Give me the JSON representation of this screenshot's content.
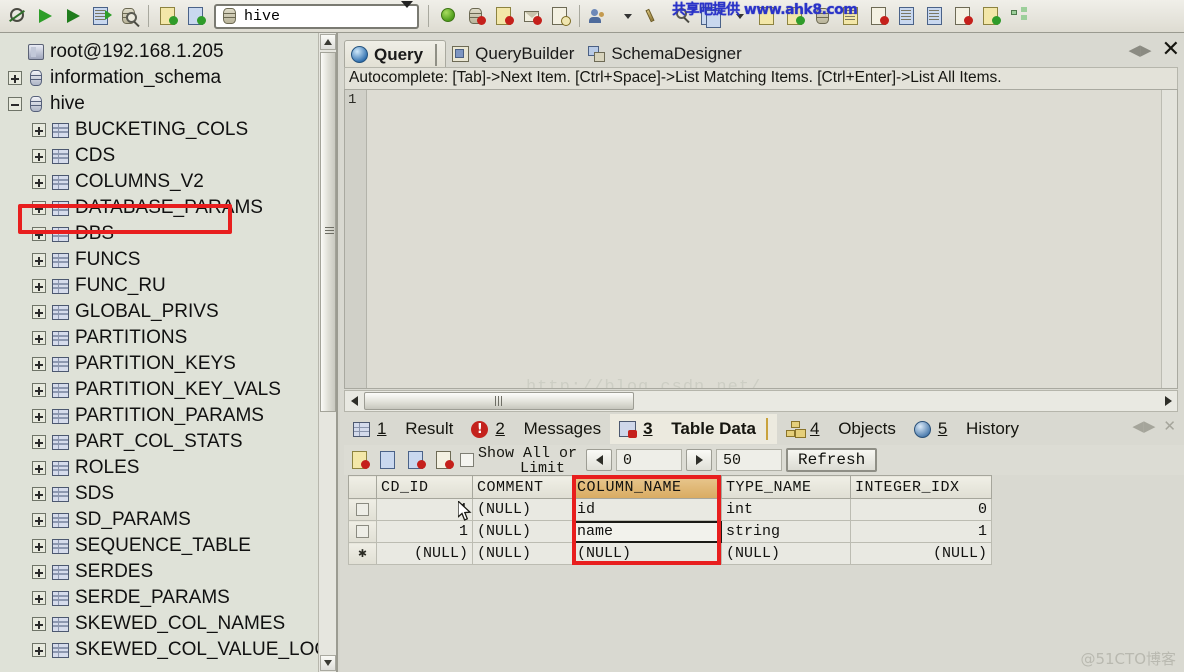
{
  "toolbar": {
    "database_value": "hive",
    "icons": [
      "connect-icon",
      "execute-icon",
      "execute-current-icon",
      "execute-to-grid-icon",
      "explain-plan-icon",
      "import-icon",
      "export-icon"
    ],
    "watermark": "共享吧提供 www.ahk8.com"
  },
  "tree": {
    "items": [
      {
        "label": "root@192.168.1.205",
        "level": 0,
        "icon": "server-icon",
        "expander": "none"
      },
      {
        "label": "information_schema",
        "level": 1,
        "icon": "database-icon",
        "expander": "plus"
      },
      {
        "label": "hive",
        "level": 1,
        "icon": "database-icon",
        "expander": "minus"
      },
      {
        "label": "BUCKETING_COLS",
        "level": 2,
        "icon": "table-icon",
        "expander": "plus"
      },
      {
        "label": "CDS",
        "level": 2,
        "icon": "table-icon",
        "expander": "plus"
      },
      {
        "label": "COLUMNS_V2",
        "level": 2,
        "icon": "table-icon",
        "expander": "plus"
      },
      {
        "label": "DATABASE_PARAMS",
        "level": 2,
        "icon": "table-icon",
        "expander": "plus"
      },
      {
        "label": "DBS",
        "level": 2,
        "icon": "table-icon",
        "expander": "plus"
      },
      {
        "label": "FUNCS",
        "level": 2,
        "icon": "table-icon",
        "expander": "plus"
      },
      {
        "label": "FUNC_RU",
        "level": 2,
        "icon": "table-icon",
        "expander": "plus"
      },
      {
        "label": "GLOBAL_PRIVS",
        "level": 2,
        "icon": "table-icon",
        "expander": "plus"
      },
      {
        "label": "PARTITIONS",
        "level": 2,
        "icon": "table-icon",
        "expander": "plus"
      },
      {
        "label": "PARTITION_KEYS",
        "level": 2,
        "icon": "table-icon",
        "expander": "plus"
      },
      {
        "label": "PARTITION_KEY_VALS",
        "level": 2,
        "icon": "table-icon",
        "expander": "plus"
      },
      {
        "label": "PARTITION_PARAMS",
        "level": 2,
        "icon": "table-icon",
        "expander": "plus"
      },
      {
        "label": "PART_COL_STATS",
        "level": 2,
        "icon": "table-icon",
        "expander": "plus"
      },
      {
        "label": "ROLES",
        "level": 2,
        "icon": "table-icon",
        "expander": "plus"
      },
      {
        "label": "SDS",
        "level": 2,
        "icon": "table-icon",
        "expander": "plus"
      },
      {
        "label": "SD_PARAMS",
        "level": 2,
        "icon": "table-icon",
        "expander": "plus"
      },
      {
        "label": "SEQUENCE_TABLE",
        "level": 2,
        "icon": "table-icon",
        "expander": "plus"
      },
      {
        "label": "SERDES",
        "level": 2,
        "icon": "table-icon",
        "expander": "plus"
      },
      {
        "label": "SERDE_PARAMS",
        "level": 2,
        "icon": "table-icon",
        "expander": "plus"
      },
      {
        "label": "SKEWED_COL_NAMES",
        "level": 2,
        "icon": "table-icon",
        "expander": "plus"
      },
      {
        "label": "SKEWED_COL_VALUE_LOC_M",
        "level": 2,
        "icon": "table-icon",
        "expander": "plus"
      }
    ],
    "highlight_label": "COLUMNS_V2",
    "highlight_color": "#e81e1e"
  },
  "query_panel": {
    "tabs": [
      {
        "label": "Query",
        "icon": "globe-icon",
        "active": true
      },
      {
        "label": "QueryBuilder",
        "icon": "query-builder-icon",
        "active": false
      },
      {
        "label": "SchemaDesigner",
        "icon": "schema-designer-icon",
        "active": false
      }
    ],
    "close_label": "✕",
    "autocomplete_hint": "Autocomplete: [Tab]->Next Item. [Ctrl+Space]->List Matching Items. [Ctrl+Enter]->List All Items.",
    "line_number": "1",
    "editor_text": "",
    "watermark": "http://blog.csdn.net/"
  },
  "results_panel": {
    "tabs": [
      {
        "number": "1",
        "label": "Result",
        "icon": "grid-icon",
        "active": false
      },
      {
        "number": "2",
        "label": "Messages",
        "icon": "error-icon",
        "active": false
      },
      {
        "number": "3",
        "label": "Table Data",
        "icon": "table-data-icon",
        "active": true
      },
      {
        "number": "4",
        "label": "Objects",
        "icon": "objects-icon",
        "active": false
      },
      {
        "number": "5",
        "label": "History",
        "icon": "history-icon",
        "active": false
      }
    ],
    "toolbar": {
      "icons": [
        "copy-icon",
        "save-icon",
        "export-icon",
        "delete-rows-icon"
      ],
      "show_all_label_line1": "Show All or",
      "show_all_label_line2": "Limit",
      "offset_value": "0",
      "limit_value": "50",
      "refresh_label": "Refresh"
    },
    "grid": {
      "columns": [
        "CD_ID",
        "COMMENT",
        "COLUMN_NAME",
        "TYPE_NAME",
        "INTEGER_IDX"
      ],
      "selected_column": "COLUMN_NAME",
      "selected_column_color": "#d9ab62",
      "highlight_color": "#e81e1e",
      "rows": [
        {
          "marker": "checkbox",
          "CD_ID": "1",
          "COMMENT": "(NULL)",
          "COLUMN_NAME": "id",
          "TYPE_NAME": "int",
          "INTEGER_IDX": "0"
        },
        {
          "marker": "checkbox",
          "CD_ID": "1",
          "COMMENT": "(NULL)",
          "COLUMN_NAME": "name",
          "TYPE_NAME": "string",
          "INTEGER_IDX": "1"
        },
        {
          "marker": "star",
          "CD_ID": "(NULL)",
          "COMMENT": "(NULL)",
          "COLUMN_NAME": "(NULL)",
          "TYPE_NAME": "(NULL)",
          "INTEGER_IDX": "(NULL)"
        }
      ],
      "editing_cell": "name"
    }
  },
  "bottom_watermark": "@51CTO博客"
}
